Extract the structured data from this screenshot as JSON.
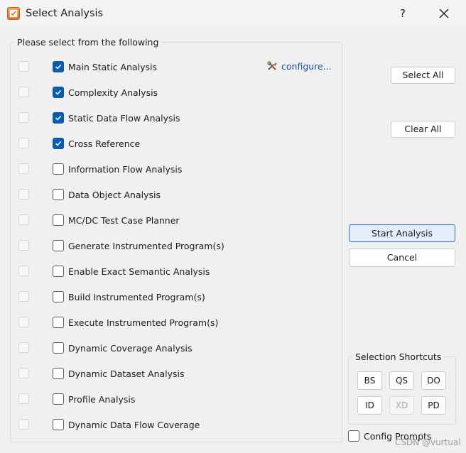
{
  "window": {
    "title": "Select Analysis",
    "help_label": "?"
  },
  "group": {
    "label": "Please select from the following"
  },
  "analyses": [
    {
      "label": "Main Static Analysis",
      "checked": true
    },
    {
      "label": "Complexity Analysis",
      "checked": true
    },
    {
      "label": "Static Data Flow Analysis",
      "checked": true
    },
    {
      "label": "Cross Reference",
      "checked": true
    },
    {
      "label": "Information Flow Analysis",
      "checked": false
    },
    {
      "label": "Data Object Analysis",
      "checked": false
    },
    {
      "label": "MC/DC Test Case Planner",
      "checked": false
    },
    {
      "label": "Generate Instrumented Program(s)",
      "checked": false
    },
    {
      "label": "Enable Exact Semantic Analysis",
      "checked": false
    },
    {
      "label": "Build Instrumented Program(s)",
      "checked": false
    },
    {
      "label": "Execute Instrumented Program(s)",
      "checked": false
    },
    {
      "label": "Dynamic Coverage Analysis",
      "checked": false
    },
    {
      "label": "Dynamic Dataset Analysis",
      "checked": false
    },
    {
      "label": "Profile Analysis",
      "checked": false
    },
    {
      "label": "Dynamic Data Flow Coverage",
      "checked": false
    }
  ],
  "configure_link": "configure...",
  "buttons": {
    "select_all": "Select All",
    "clear_all": "Clear All",
    "start_analysis": "Start Analysis",
    "cancel": "Cancel"
  },
  "shortcuts": {
    "label": "Selection Shortcuts",
    "items": [
      {
        "label": "BS",
        "enabled": true
      },
      {
        "label": "QS",
        "enabled": true
      },
      {
        "label": "DO",
        "enabled": true
      },
      {
        "label": "ID",
        "enabled": true
      },
      {
        "label": "XD",
        "enabled": false
      },
      {
        "label": "PD",
        "enabled": true
      }
    ]
  },
  "config_prompts": {
    "label": "Config Prompts",
    "checked": false
  },
  "watermark": "CSDN @vurtual",
  "colors": {
    "accent": "#0b5cad",
    "link": "#1f4fa8",
    "primary_border": "#2f6fc9"
  }
}
